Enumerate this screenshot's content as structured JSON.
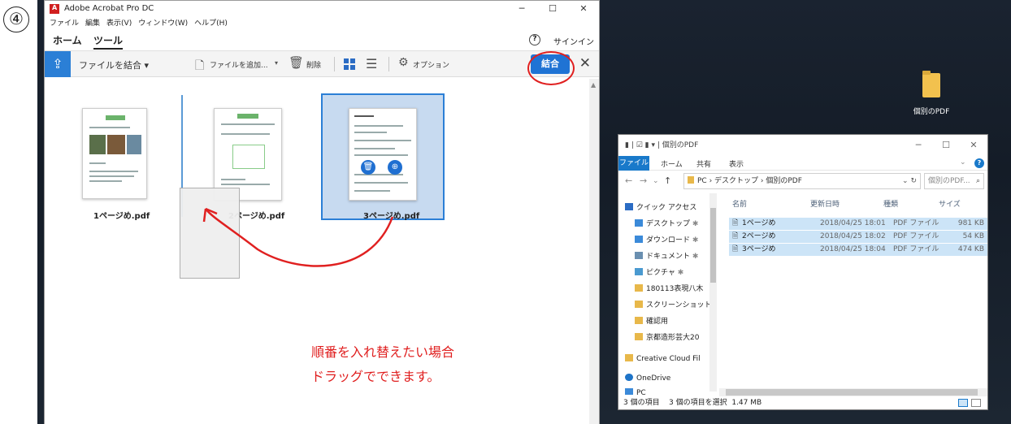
{
  "step_number": "④",
  "acrobat": {
    "window_title": "Adobe Acrobat Pro DC",
    "menu": [
      "ファイル",
      "編集",
      "表示(V)",
      "ウィンドウ(W)",
      "ヘルプ(H)"
    ],
    "tabs": {
      "home": "ホーム",
      "tools": "ツール"
    },
    "help_glyph": "?",
    "signin": "サインイン",
    "toolbar": {
      "combine_files": "ファイルを結合 ▾",
      "add_file": "ファイルを追加...",
      "delete": "削除",
      "options": "オプション",
      "combine_button": "結合"
    },
    "pages": [
      {
        "label": "1ページめ.pdf"
      },
      {
        "label": "2ページめ.pdf"
      },
      {
        "label": "3ページめ.pdf"
      }
    ],
    "annotation": [
      "順番を入れ替えたい場合",
      "ドラッグでできます。"
    ]
  },
  "desktop": {
    "folder_label": "個別のPDF"
  },
  "explorer": {
    "title": "個別のPDF",
    "ribbon_tabs": [
      "ファイル",
      "ホーム",
      "共有",
      "表示"
    ],
    "address": "PC › デスクトップ › 個別のPDF",
    "search_placeholder": "個別のPDF...",
    "nav_items": [
      {
        "label": "クイック アクセス",
        "color": "#2b6cc4"
      },
      {
        "label": "デスクトップ",
        "color": "#3b8ad9"
      },
      {
        "label": "ダウンロード",
        "color": "#3b8ad9"
      },
      {
        "label": "ドキュメント",
        "color": "#6a8fb0"
      },
      {
        "label": "ピクチャ",
        "color": "#4a9ad0"
      },
      {
        "label": "180113表現八木",
        "color": "#e8b84a"
      },
      {
        "label": "スクリーンショット",
        "color": "#e8b84a"
      },
      {
        "label": "確認用",
        "color": "#e8b84a"
      },
      {
        "label": "京都造形芸大20",
        "color": "#e8b84a"
      },
      {
        "label": "Creative Cloud Fil",
        "color": "#e8b84a"
      },
      {
        "label": "OneDrive",
        "color": "#1e74c8"
      },
      {
        "label": "PC",
        "color": "#3b8ad9"
      }
    ],
    "columns": {
      "name": "名前",
      "date": "更新日時",
      "type": "種類",
      "size": "サイズ"
    },
    "files": [
      {
        "name": "1ページめ",
        "date": "2018/04/25 18:01",
        "type": "PDF ファイル",
        "size": "981 KB"
      },
      {
        "name": "2ページめ",
        "date": "2018/04/25 18:02",
        "type": "PDF ファイル",
        "size": "54 KB"
      },
      {
        "name": "3ページめ",
        "date": "2018/04/25 18:04",
        "type": "PDF ファイル",
        "size": "474 KB"
      }
    ],
    "status": "3 個の項目    3 個の項目を選択  1.47 MB"
  },
  "colors": {
    "accent": "#1f73d4",
    "annotation": "#e02020"
  }
}
